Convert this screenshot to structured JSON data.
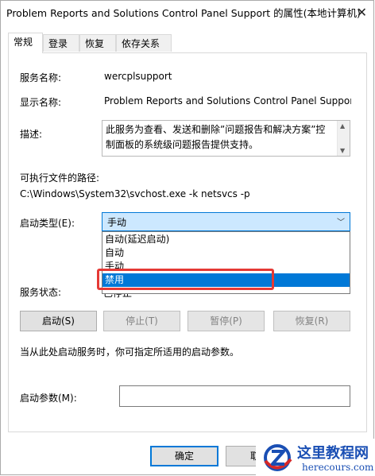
{
  "window": {
    "title": "Problem Reports and Solutions Control Panel Support 的属性(本地计算机)",
    "close_glyph": "✕"
  },
  "tabs": [
    {
      "label": "常规",
      "active": true
    },
    {
      "label": "登录",
      "active": false
    },
    {
      "label": "恢复",
      "active": false
    },
    {
      "label": "依存关系",
      "active": false
    }
  ],
  "general": {
    "service_name_label": "服务名称:",
    "service_name_value": "wercplsupport",
    "display_name_label": "显示名称:",
    "display_name_value": "Problem Reports and Solutions Control Panel Suppor",
    "description_label": "描述:",
    "description_value": "此服务为查看、发送和删除”问题报告和解决方案”控制面板的系统级问题报告提供支持。",
    "exe_path_label": "可执行文件的路径:",
    "exe_path_value": "C:\\Windows\\System32\\svchost.exe -k netsvcs -p",
    "startup_type_label": "启动类型(E):",
    "startup_type_value": "手动",
    "startup_options": [
      {
        "label": "自动(延迟启动)",
        "selected": false
      },
      {
        "label": "自动",
        "selected": false
      },
      {
        "label": "手动",
        "selected": false
      },
      {
        "label": "禁用",
        "selected": true
      }
    ],
    "service_status_label": "服务状态:",
    "service_status_value": "已停止",
    "buttons": {
      "start": "启动(S)",
      "stop": "停止(T)",
      "pause": "暂停(P)",
      "resume": "恢复(R)"
    },
    "hint_text": "当从此处启动服务时，你可指定所适用的启动参数。",
    "start_params_label": "启动参数(M):",
    "start_params_value": ""
  },
  "footer": {
    "ok": "确定",
    "cancel": "取"
  },
  "watermark": {
    "name_cn": "这里教程网",
    "domain": "herecours.com"
  },
  "colors": {
    "accent": "#0078d7",
    "selected_combo": "#cce8ff",
    "highlight_box": "#e53935",
    "watermark_text": "#1a4fb4"
  }
}
